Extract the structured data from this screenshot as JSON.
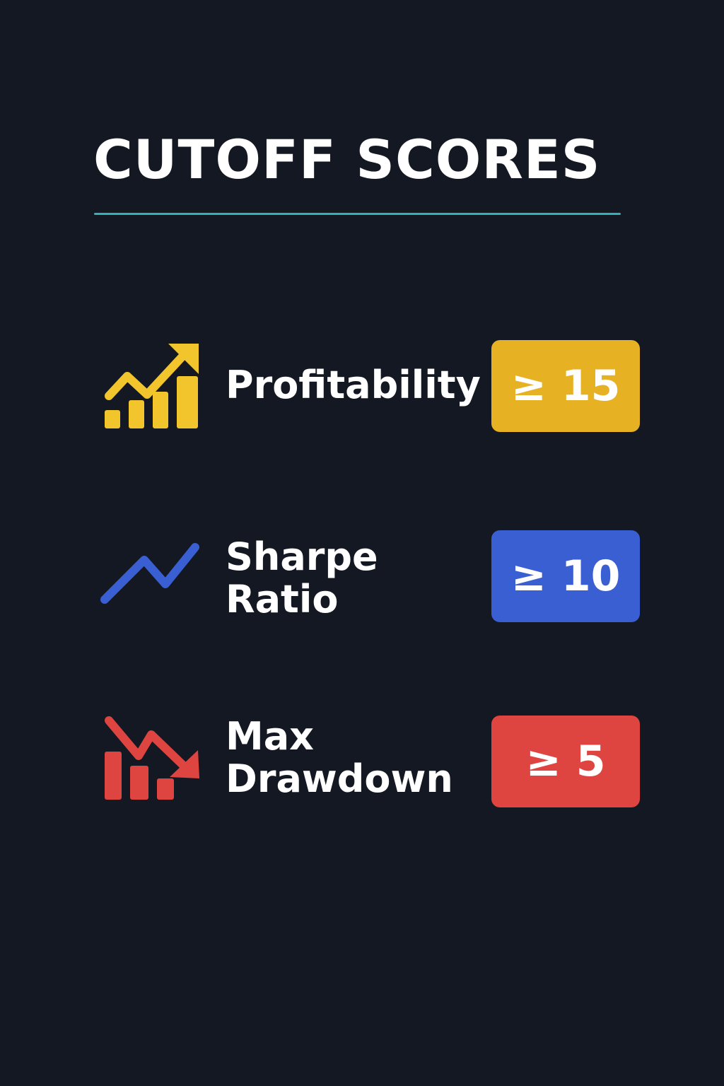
{
  "header": {
    "title": "CUTOFF SCORES"
  },
  "metrics": [
    {
      "label_lines": [
        "Profitability"
      ],
      "cutoff": "≥ 15",
      "icon": "bar-chart-up-arrow-icon",
      "color": "#e6b224"
    },
    {
      "label_lines": [
        "Sharpe",
        "Ratio"
      ],
      "cutoff": "≥ 10",
      "icon": "trend-line-icon",
      "color": "#3a5fd2"
    },
    {
      "label_lines": [
        "Max",
        "Drawdown"
      ],
      "cutoff": "≥ 5",
      "icon": "bar-chart-down-arrow-icon",
      "color": "#de4540"
    }
  ],
  "colors": {
    "background": "#141823",
    "divider": "#2fb3b8",
    "text": "#ffffff"
  }
}
